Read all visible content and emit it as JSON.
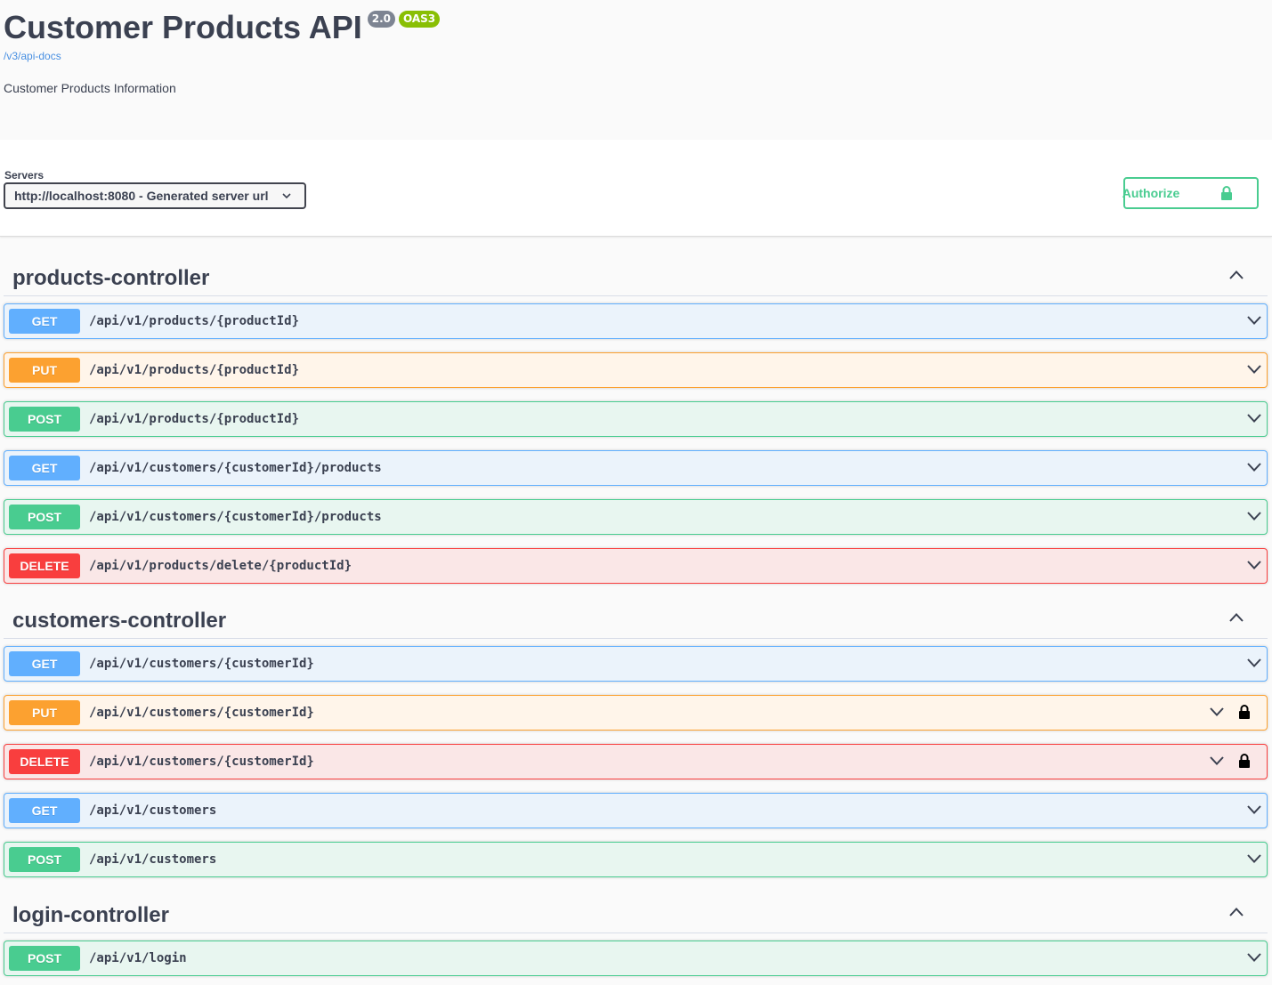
{
  "info": {
    "title": "Customer Products API",
    "version_badge": "2.0",
    "oas_badge": "OAS3",
    "spec_link": "/v3/api-docs",
    "description": "Customer Products Information"
  },
  "servers": {
    "label": "Servers",
    "selected": "http://localhost:8080 - Generated server url"
  },
  "authorize": {
    "label": "Authorize"
  },
  "tags": [
    {
      "name": "products-controller",
      "operations": [
        {
          "method": "GET",
          "path": "/api/v1/products/{productId}",
          "locked": false
        },
        {
          "method": "PUT",
          "path": "/api/v1/products/{productId}",
          "locked": false
        },
        {
          "method": "POST",
          "path": "/api/v1/products/{productId}",
          "locked": false
        },
        {
          "method": "GET",
          "path": "/api/v1/customers/{customerId}/products",
          "locked": false
        },
        {
          "method": "POST",
          "path": "/api/v1/customers/{customerId}/products",
          "locked": false
        },
        {
          "method": "DELETE",
          "path": "/api/v1/products/delete/{productId}",
          "locked": false
        }
      ]
    },
    {
      "name": "customers-controller",
      "operations": [
        {
          "method": "GET",
          "path": "/api/v1/customers/{customerId}",
          "locked": false
        },
        {
          "method": "PUT",
          "path": "/api/v1/customers/{customerId}",
          "locked": true
        },
        {
          "method": "DELETE",
          "path": "/api/v1/customers/{customerId}",
          "locked": true
        },
        {
          "method": "GET",
          "path": "/api/v1/customers",
          "locked": false
        },
        {
          "method": "POST",
          "path": "/api/v1/customers",
          "locked": false
        }
      ]
    },
    {
      "name": "login-controller",
      "operations": [
        {
          "method": "POST",
          "path": "/api/v1/login",
          "locked": false
        }
      ]
    }
  ],
  "colors": {
    "get": "#61affe",
    "put": "#fca130",
    "post": "#49cc90",
    "delete": "#f93e3e",
    "badge_version": "#7d8492",
    "badge_oas": "#89bf04",
    "link": "#4990e2"
  },
  "icons": [
    "chevron-down-icon",
    "chevron-up-icon",
    "lock-icon"
  ]
}
